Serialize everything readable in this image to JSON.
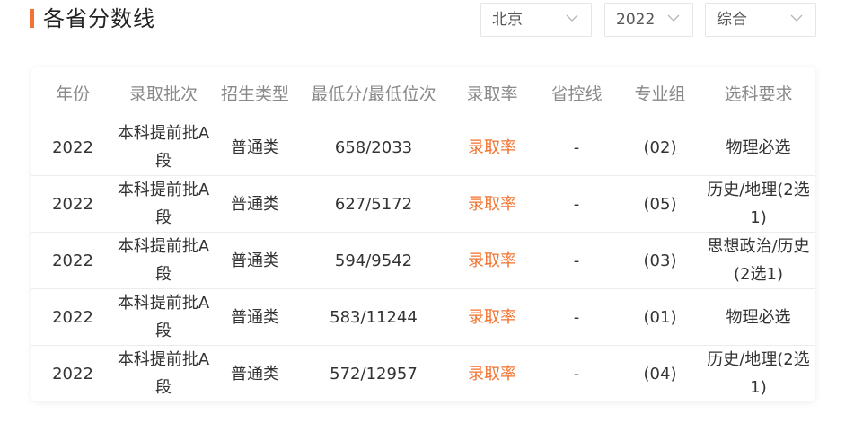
{
  "header": {
    "title": "各省分数线"
  },
  "filters": {
    "city": "北京",
    "year": "2022",
    "subject_type": "综合"
  },
  "table": {
    "columns": [
      "年份",
      "录取批次",
      "招生类型",
      "最低分/最低位次",
      "录取率",
      "省控线",
      "专业组",
      "选科要求"
    ],
    "rows": [
      [
        "2022",
        "本科提前批A段",
        "普通类",
        "658/2033",
        "录取率",
        "-",
        "(02)",
        "物理必选"
      ],
      [
        "2022",
        "本科提前批A段",
        "普通类",
        "627/5172",
        "录取率",
        "-",
        "(05)",
        "历史/地理(2选1)"
      ],
      [
        "2022",
        "本科提前批A段",
        "普通类",
        "594/9542",
        "录取率",
        "-",
        "(03)",
        "思想政治/历史(2选1)"
      ],
      [
        "2022",
        "本科提前批A段",
        "普通类",
        "583/11244",
        "录取率",
        "-",
        "(01)",
        "物理必选"
      ],
      [
        "2022",
        "本科提前批A段",
        "普通类",
        "572/12957",
        "录取率",
        "-",
        "(04)",
        "历史/地理(2选1)"
      ]
    ]
  },
  "colors": {
    "accent": "#f2732f",
    "header_text": "#8a8a8a",
    "border": "#ececec"
  },
  "icons": {
    "dropdown": "chevron-down-icon"
  }
}
